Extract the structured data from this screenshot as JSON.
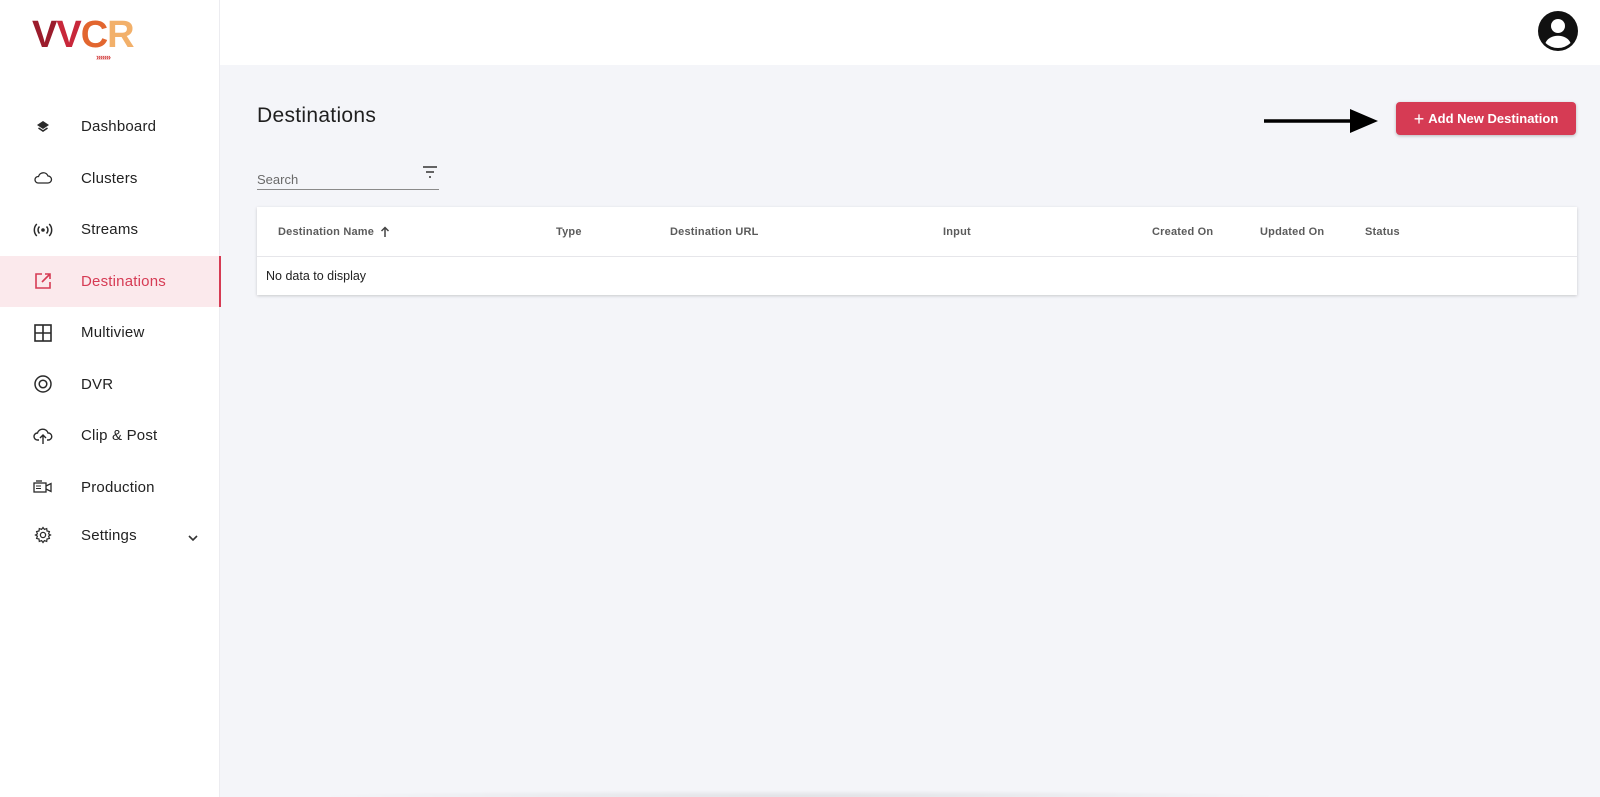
{
  "app": {
    "logo_text": [
      "V",
      "V",
      "C",
      "R"
    ],
    "logo_chevrons": "›››››››"
  },
  "sidebar": {
    "items": [
      {
        "label": "Dashboard",
        "icon": "layers-icon"
      },
      {
        "label": "Clusters",
        "icon": "cloud-icon"
      },
      {
        "label": "Streams",
        "icon": "broadcast-icon"
      },
      {
        "label": "Destinations",
        "icon": "external-link-icon",
        "active": true
      },
      {
        "label": "Multiview",
        "icon": "grid-icon"
      },
      {
        "label": "DVR",
        "icon": "record-icon"
      },
      {
        "label": "Clip & Post",
        "icon": "cloud-upload-icon"
      },
      {
        "label": "Production",
        "icon": "video-camera-icon"
      },
      {
        "label": "Settings",
        "icon": "gear-icon",
        "expandable": true
      }
    ]
  },
  "header": {
    "avatar_icon": "user-avatar-icon"
  },
  "main": {
    "title": "Destinations",
    "add_button_label": "Add New Destination",
    "add_button_icon": "plus-icon",
    "search": {
      "placeholder": "Search",
      "value": ""
    },
    "filter_icon": "filter-icon",
    "table": {
      "columns": [
        "Destination Name",
        "Type",
        "Destination URL",
        "Input",
        "Created On",
        "Updated On",
        "Status"
      ],
      "sorted_column": "Destination Name",
      "sort_direction": "ascending",
      "empty_message": "No data to display"
    }
  },
  "colors": {
    "accent": "#d63b54",
    "active_bg": "#fbe9ec",
    "page_bg": "#f4f5f9"
  }
}
